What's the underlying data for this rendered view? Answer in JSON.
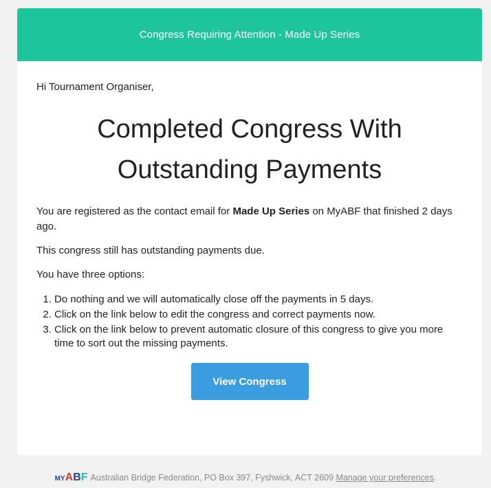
{
  "banner": {
    "title": "Congress Requiring Attention - Made Up Series"
  },
  "body": {
    "greeting": "Hi Tournament Organiser,",
    "headline_line1": "Completed Congress With",
    "headline_line2": "Outstanding Payments",
    "intro_before": "You are registered as the contact email for ",
    "congress_name": "Made Up Series",
    "intro_after": " on MyABF that finished 2 days ago.",
    "status": "This congress still has outstanding payments due.",
    "options_intro": "You have three options:",
    "options": [
      "Do nothing and we will automatically close off the payments in 5 days.",
      "Click on the link below to edit the congress and correct payments now.",
      "Click on the link below to prevent automatic closure of this congress to give you more time to sort out the missing payments."
    ],
    "cta_label": "View Congress"
  },
  "footer": {
    "logo_my": "MY",
    "logo_a": "A",
    "logo_b": "B",
    "logo_f": "F",
    "address": "Australian Bridge Federation, PO Box 397, Fyshwick, ACT 2609",
    "manage_link": "Manage your preferences",
    "trailing": "."
  },
  "colors": {
    "banner": "#1ec49b",
    "button": "#3a9de0",
    "page_bg": "#f1f1f1"
  }
}
